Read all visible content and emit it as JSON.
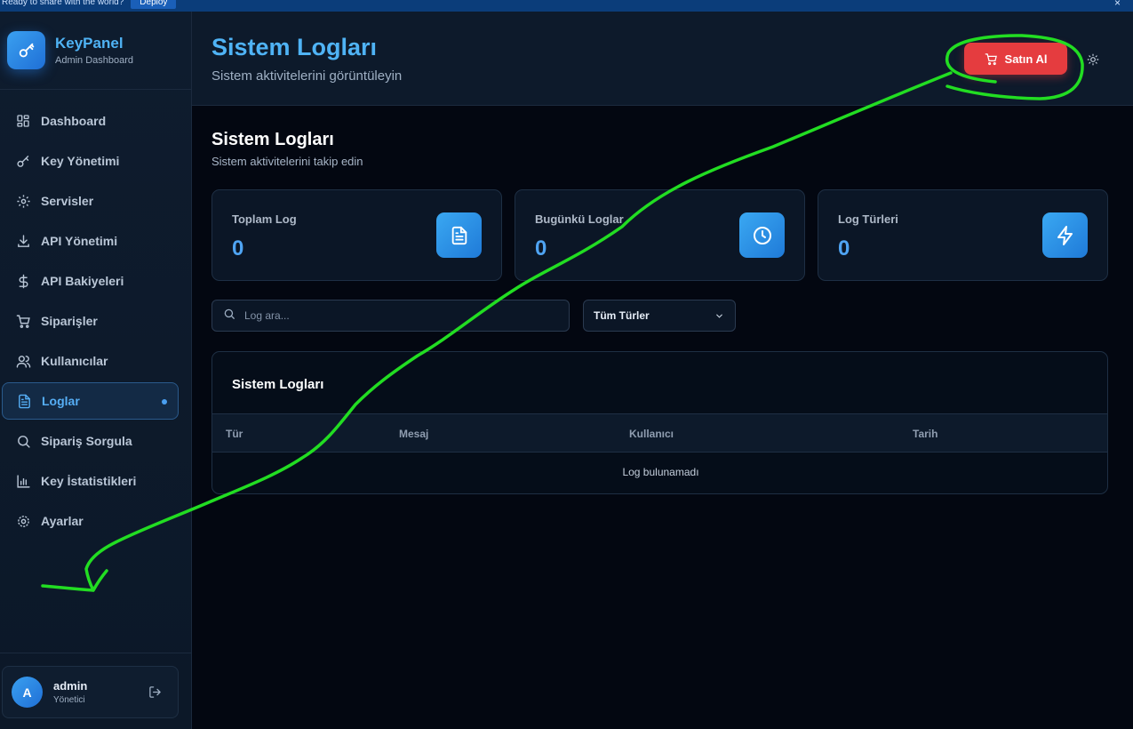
{
  "topbar": {
    "message": "Ready to share with the world?",
    "deploy_label": "Deploy",
    "close_glyph": "×"
  },
  "brand": {
    "title": "KeyPanel",
    "subtitle": "Admin Dashboard",
    "icon": "key-icon"
  },
  "sidebar": {
    "items": [
      {
        "label": "Dashboard",
        "icon": "dashboard-icon"
      },
      {
        "label": "Key Yönetimi",
        "icon": "key-icon"
      },
      {
        "label": "Servisler",
        "icon": "gear-icon"
      },
      {
        "label": "API Yönetimi",
        "icon": "download-icon"
      },
      {
        "label": "API Bakiyeleri",
        "icon": "dollar-icon"
      },
      {
        "label": "Siparişler",
        "icon": "cart-icon"
      },
      {
        "label": "Kullanıcılar",
        "icon": "users-icon"
      },
      {
        "label": "Loglar",
        "icon": "file-icon",
        "active": true
      },
      {
        "label": "Sipariş Sorgula",
        "icon": "search-icon"
      },
      {
        "label": "Key İstatistikleri",
        "icon": "bar-chart-icon"
      },
      {
        "label": "Ayarlar",
        "icon": "cog-icon"
      }
    ]
  },
  "user": {
    "initial": "A",
    "name": "admin",
    "role": "Yönetici"
  },
  "header": {
    "title": "Sistem Logları",
    "subtitle": "Sistem aktivitelerini görüntüleyin",
    "buy_label": "Satın Al"
  },
  "main": {
    "title": "Sistem Logları",
    "subtitle": "Sistem aktivitelerini takip edin",
    "cards": [
      {
        "label": "Toplam Log",
        "value": "0",
        "icon": "document-icon"
      },
      {
        "label": "Bugünkü Loglar",
        "value": "0",
        "icon": "clock-icon"
      },
      {
        "label": "Log Türleri",
        "value": "0",
        "icon": "lightning-icon"
      }
    ],
    "search_placeholder": "Log ara...",
    "filter_selected": "Tüm Türler",
    "table": {
      "title": "Sistem Logları",
      "columns": [
        "Tür",
        "Mesaj",
        "Kullanıcı",
        "Tarih"
      ],
      "empty_text": "Log bulunamadı"
    }
  },
  "colors": {
    "accent": "#4fb3f5",
    "buy_button": "#e53c3f",
    "annotation": "#22dd22"
  }
}
